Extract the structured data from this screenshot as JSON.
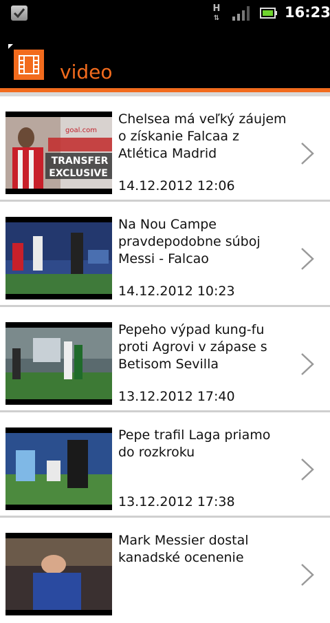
{
  "status": {
    "network": "H",
    "time": "16:23"
  },
  "header": {
    "title": "video"
  },
  "videos": [
    {
      "title": "Chelsea má veľký záujem o získanie Falcaa z Atlética Madrid",
      "date": "14.12.2012 12:06",
      "overlay_line1": "TRANSFER",
      "overlay_line2": "EXCLUSIVE",
      "overlay_brand": "goal.com"
    },
    {
      "title": "Na Nou Campe pravdepodobne súboj Messi - Falcao",
      "date": "14.12.2012 10:23"
    },
    {
      "title": "Pepeho výpad kung-fu proti Agrovi v zápase s Betisom Sevilla",
      "date": "13.12.2012 17:40"
    },
    {
      "title": "Pepe trafil Laga priamo do rozkroku",
      "date": "13.12.2012 17:38"
    },
    {
      "title": "Mark Messier dostal kanadské ocenenie",
      "date": ""
    }
  ],
  "colors": {
    "accent": "#f26b1d",
    "background": "#ffffff",
    "header": "#000000"
  }
}
